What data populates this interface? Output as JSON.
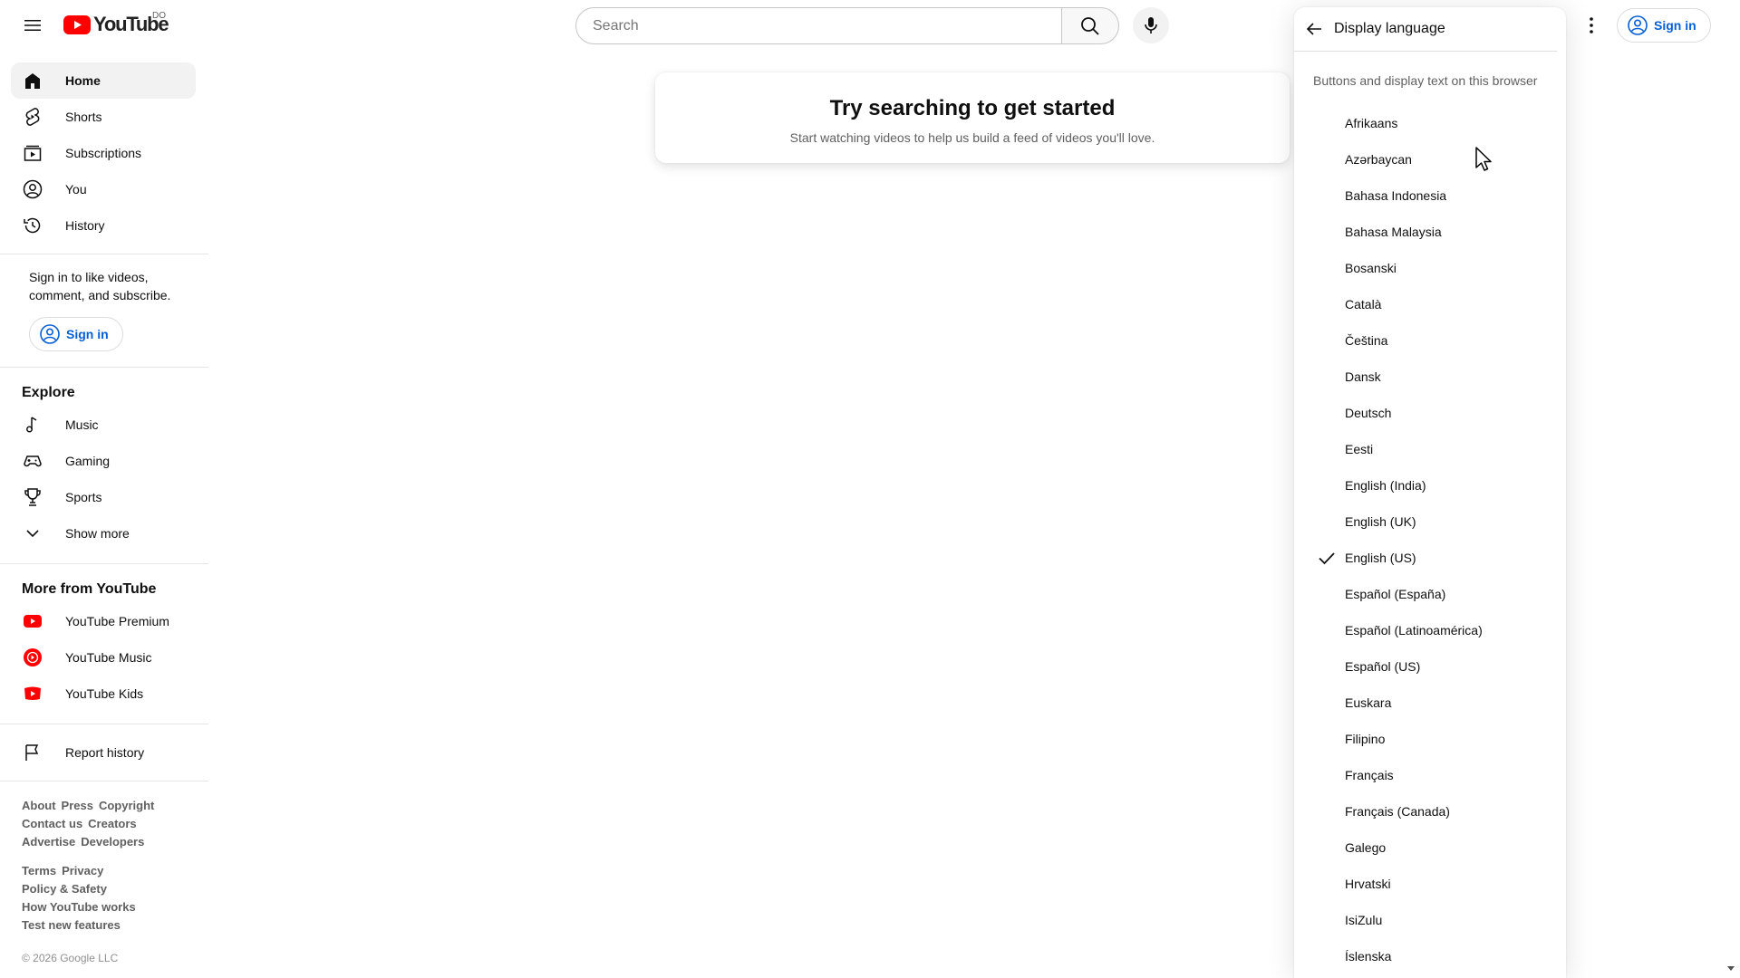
{
  "masthead": {
    "logo_text": "YouTube",
    "country_code": "DO",
    "search_placeholder": "Search",
    "signin_label": "Sign in"
  },
  "sidebar": {
    "main_items": [
      {
        "label": "Home",
        "icon": "home-icon",
        "active": true
      },
      {
        "label": "Shorts",
        "icon": "shorts-icon"
      },
      {
        "label": "Subscriptions",
        "icon": "subscriptions-icon"
      },
      {
        "label": "You",
        "icon": "you-icon"
      },
      {
        "label": "History",
        "icon": "history-icon"
      }
    ],
    "signin_message": "Sign in to like videos, comment, and subscribe.",
    "signin_label": "Sign in",
    "explore_title": "Explore",
    "explore_items": [
      {
        "label": "Music",
        "icon": "music-icon"
      },
      {
        "label": "Gaming",
        "icon": "gaming-icon"
      },
      {
        "label": "Sports",
        "icon": "trophy-icon"
      },
      {
        "label": "Show more",
        "icon": "chevron-down-icon"
      }
    ],
    "more_title": "More from YouTube",
    "more_items": [
      {
        "label": "YouTube Premium",
        "icon": "youtube-premium-icon"
      },
      {
        "label": "YouTube Music",
        "icon": "youtube-music-icon"
      },
      {
        "label": "YouTube Kids",
        "icon": "youtube-kids-icon"
      }
    ],
    "report_history": "Report history",
    "footer_links_1": [
      "About",
      "Press",
      "Copyright",
      "Contact us",
      "Creators",
      "Advertise",
      "Developers"
    ],
    "footer_links_2": [
      "Terms",
      "Privacy",
      "Policy & Safety",
      "How YouTube works",
      "Test new features"
    ],
    "copyright": "© 2026 Google LLC"
  },
  "main": {
    "empty_title": "Try searching to get started",
    "empty_subtitle": "Start watching videos to help us build a feed of videos you'll love."
  },
  "language_panel": {
    "title": "Display language",
    "subtitle": "Buttons and display text on this browser",
    "selected": "English (US)",
    "languages": [
      "Afrikaans",
      "Azərbaycan",
      "Bahasa Indonesia",
      "Bahasa Malaysia",
      "Bosanski",
      "Català",
      "Čeština",
      "Dansk",
      "Deutsch",
      "Eesti",
      "English (India)",
      "English (UK)",
      "English (US)",
      "Español (España)",
      "Español (Latinoamérica)",
      "Español (US)",
      "Euskara",
      "Filipino",
      "Français",
      "Français (Canada)",
      "Galego",
      "Hrvatski",
      "IsiZulu",
      "Íslenska"
    ]
  },
  "colors": {
    "brand_red": "#ff0000",
    "link_blue": "#065fd4"
  }
}
